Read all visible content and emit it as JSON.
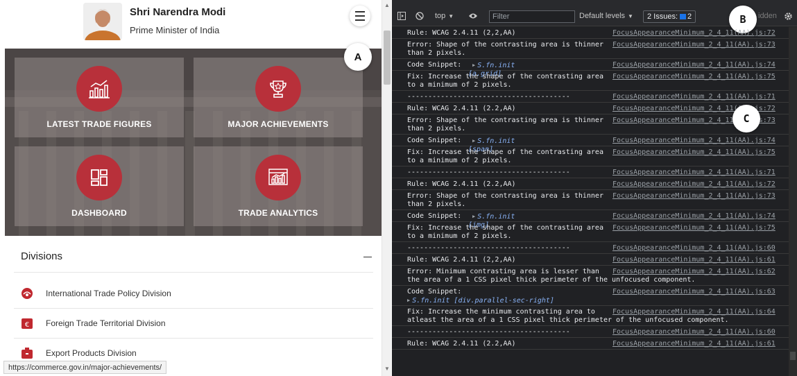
{
  "header": {
    "name": "Shri Narendra Modi",
    "title": "Prime Minister of India"
  },
  "tiles": [
    {
      "label": "LATEST TRADE FIGURES",
      "icon": "bar-chart-icon"
    },
    {
      "label": "MAJOR ACHIEVEMENTS",
      "icon": "trophy-icon"
    },
    {
      "label": "DASHBOARD",
      "icon": "dashboard-icon"
    },
    {
      "label": "TRADE ANALYTICS",
      "icon": "analytics-icon"
    }
  ],
  "badges": {
    "a": "A",
    "b": "B",
    "c": "C"
  },
  "divisions": {
    "title": "Divisions",
    "items": [
      {
        "label": "International Trade Policy Division",
        "icon": "globe-handshake-icon"
      },
      {
        "label": "Foreign Trade Territorial Division",
        "icon": "currency-icon"
      },
      {
        "label": "Export Products Division",
        "icon": "package-icon"
      }
    ]
  },
  "status_url": "https://commerce.gov.in/major-achievements/",
  "devtools": {
    "context": "top",
    "filter_placeholder": "Filter",
    "levels": "Default levels",
    "issues_label": "2 Issues:",
    "issues_count": "2",
    "hidden": "idden",
    "rows": [
      {
        "msg": "Rule: WCAG 2.4.11 (2,2,AA)",
        "src": "FocusAppearanceMinimum_2_4_11(AA).js:72"
      },
      {
        "msg": "Error: Shape of the contrasting area is thinner\nthan 2 pixels.",
        "src": "FocusAppearanceMinimum_2_4_11(AA).js:73"
      },
      {
        "msg": "Code Snippet:",
        "snippet": "S.fn.init [a.grid]",
        "src": "FocusAppearanceMinimum_2_4_11(AA).js:74"
      },
      {
        "msg": "Fix: Increase the shape of the contrasting area\nto a minimum of 2 pixels.",
        "src": "FocusAppearanceMinimum_2_4_11(AA).js:75"
      },
      {
        "msg": "---------------------------------------",
        "src": "FocusAppearanceMinimum_2_4_11(AA).js:71"
      },
      {
        "msg": "Rule: WCAG 2.4.11 (2.2,AA)",
        "src": "FocusAppearanceMinimum_2_4_11(AA).js:72"
      },
      {
        "msg": "Error: Shape of the contrasting area is thinner\nthan 2 pixels.",
        "src": "FocusAppearanceMinimum_2_4_11(AA).js:73"
      },
      {
        "msg": "Code Snippet:",
        "snippet": "S.fn.init [span]",
        "src": "FocusAppearanceMinimum_2_4_11(AA).js:74"
      },
      {
        "msg": "Fix: Increase the shape of the contrasting area\nto a minimum of 2 pixels.",
        "src": "FocusAppearanceMinimum_2_4_11(AA).js:75"
      },
      {
        "msg": "---------------------------------------",
        "src": "FocusAppearanceMinimum_2_4_11(AA).js:71"
      },
      {
        "msg": "Rule: WCAG 2.4.11 (2.2,AA)",
        "src": "FocusAppearanceMinimum_2_4_11(AA).js:72"
      },
      {
        "msg": "Error: Shape of the contrasting area is thinner\nthan 2 pixels.",
        "src": "FocusAppearanceMinimum_2_4_11(AA).js:73"
      },
      {
        "msg": "Code Snippet:",
        "snippet": "S.fn.init [img]",
        "src": "FocusAppearanceMinimum_2_4_11(AA).js:74"
      },
      {
        "msg": "Fix: Increase the shape of the contrasting area\nto a minimum of 2 pixels.",
        "src": "FocusAppearanceMinimum_2_4_11(AA).js:75"
      },
      {
        "msg": "---------------------------------------",
        "src": "FocusAppearanceMinimum_2_4_11(AA).js:60"
      },
      {
        "msg": "Rule: WCAG 2.4.11 (2,2,AA)",
        "src": "FocusAppearanceMinimum_2_4_11(AA).js:61"
      },
      {
        "msg": "Error: Minimum contrasting area is lesser than",
        "wide": "the area of a 1 CSS pixel thick perimeter of the unfocused component.",
        "src": "FocusAppearanceMinimum_2_4_11(AA).js:62"
      },
      {
        "msg": "Code Snippet:",
        "snippet2": "S.fn.init [div.parallel-sec-right]",
        "src": "FocusAppearanceMinimum_2_4_11(AA).js:63"
      },
      {
        "msg": "Fix: Increase the minimum contrasting area to",
        "wide": "atleast the area of a 1 CSS pixel thick perimeter of the unfocused component.",
        "src": "FocusAppearanceMinimum_2_4_11(AA).js:64"
      },
      {
        "msg": "---------------------------------------",
        "src": "FocusAppearanceMinimum_2_4_11(AA).js:60"
      },
      {
        "msg": "Rule: WCAG 2.4.11 (2.2,AA)",
        "src": "FocusAppearanceMinimum_2_4_11(AA).js:61"
      }
    ]
  },
  "colors": {
    "accent_red": "#b8303a",
    "console_bg": "#202124",
    "link_grey": "#9aa0a6",
    "snippet_blue": "#8ab4f8"
  }
}
